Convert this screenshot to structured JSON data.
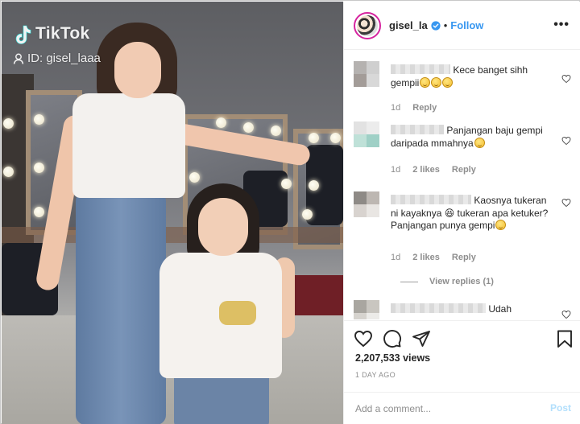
{
  "media": {
    "watermark": {
      "brand": "TikTok",
      "id_text": "ID: gisel_laaa",
      "logo_icon": "tiktok-note-icon",
      "person_icon": "person-icon"
    }
  },
  "header": {
    "username": "gisel_la",
    "verified_icon": "verified-badge-icon",
    "separator": "•",
    "follow_label": "Follow",
    "more_icon": "more-horizontal-icon"
  },
  "comments": [
    {
      "text": "Kece banget sihh gempii",
      "time": "1d",
      "likes": "",
      "reply_label": "Reply",
      "emoji_count": 3
    },
    {
      "text": "Panjangan baju gempi daripada mmahnya",
      "time": "1d",
      "likes": "2 likes",
      "reply_label": "Reply",
      "emoji_count": 1
    },
    {
      "text": "Kaosnya tukeran ni kayaknya 😆 tukeran apa ketuker? Panjangan punya gempi",
      "time": "1d",
      "likes": "2 likes",
      "reply_label": "Reply",
      "emoji_count": 1,
      "view_replies": "View replies (1)"
    },
    {
      "text": "Udah",
      "time": "",
      "likes": "",
      "reply_label": "",
      "emoji_count": 0
    }
  ],
  "actions": {
    "like_icon": "heart-icon",
    "comment_icon": "comment-bubble-icon",
    "share_icon": "paper-plane-icon",
    "save_icon": "bookmark-icon"
  },
  "stats": {
    "views": "2,207,533 views",
    "posted": "1 DAY AGO"
  },
  "composer": {
    "placeholder": "Add a comment...",
    "post_label": "Post"
  },
  "colors": {
    "link_blue": "#3897f0",
    "post_disabled": "#b2dffc",
    "muted": "#8e8e8e",
    "text": "#262626"
  }
}
